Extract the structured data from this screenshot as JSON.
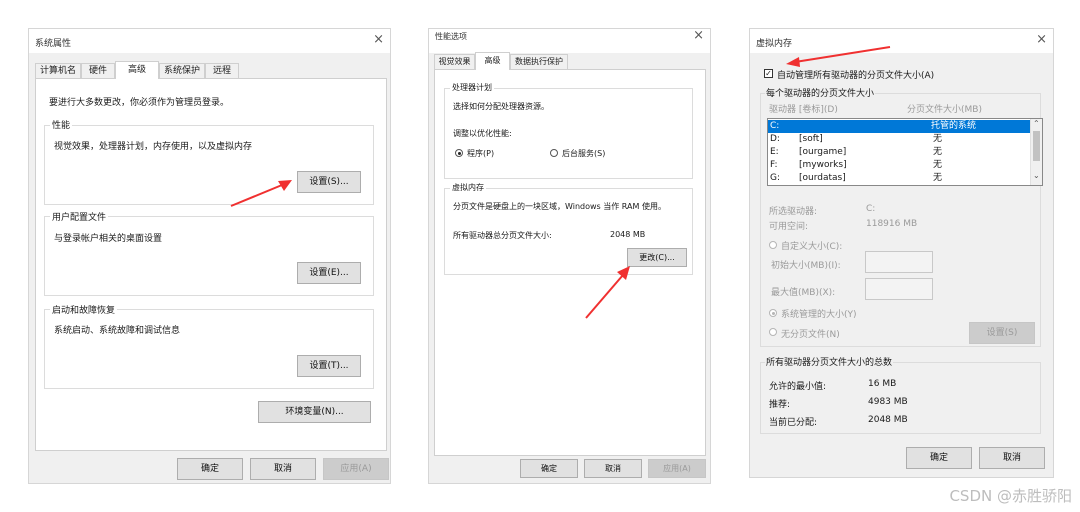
{
  "win1": {
    "title": "系统属性",
    "close": "×",
    "tabs": [
      "计算机名",
      "硬件",
      "高级",
      "系统保护",
      "远程"
    ],
    "intro": "要进行大多数更改，你必须作为管理员登录。",
    "perf_title": "性能",
    "perf_desc": "视觉效果，处理器计划，内存使用，以及虚拟内存",
    "perf_btn": "设置(S)...",
    "profile_title": "用户配置文件",
    "profile_desc": "与登录帐户相关的桌面设置",
    "profile_btn": "设置(E)...",
    "startup_title": "启动和故障恢复",
    "startup_desc": "系统启动、系统故障和调试信息",
    "startup_btn": "设置(T)...",
    "env_btn": "环境变量(N)...",
    "ok": "确定",
    "cancel": "取消",
    "apply": "应用(A)"
  },
  "win2": {
    "title": "性能选项",
    "close": "×",
    "tabs": [
      "视觉效果",
      "高级",
      "数据执行保护"
    ],
    "sched_title": "处理器计划",
    "sched_desc": "选择如何分配处理器资源。",
    "adjust_label": "调整以优化性能:",
    "radio_programs": "程序(P)",
    "radio_background": "后台服务(S)",
    "vm_title": "虚拟内存",
    "vm_desc": "分页文件是硬盘上的一块区域，Windows 当作 RAM 使用。",
    "vm_total_label": "所有驱动器总分页文件大小:",
    "vm_total_value": "2048 MB",
    "change_btn": "更改(C)...",
    "ok": "确定",
    "cancel": "取消",
    "apply": "应用(A)"
  },
  "win3": {
    "title": "虚拟内存",
    "close": "×",
    "auto_manage": "自动管理所有驱动器的分页文件大小(A)",
    "per_drive_title": "每个驱动器的分页文件大小",
    "col_drive": "驱动器 [卷标](D)",
    "col_size": "分页文件大小(MB)",
    "drives": [
      {
        "drive": "C:",
        "label": "",
        "size": "托管的系统",
        "selected": true
      },
      {
        "drive": "D:",
        "label": "[soft]",
        "size": "无",
        "selected": false
      },
      {
        "drive": "E:",
        "label": "[ourgame]",
        "size": "无",
        "selected": false
      },
      {
        "drive": "F:",
        "label": "[myworks]",
        "size": "无",
        "selected": false
      },
      {
        "drive": "G:",
        "label": "[ourdatas]",
        "size": "无",
        "selected": false
      }
    ],
    "selected_drive_label": "所选驱动器:",
    "selected_drive_value": "C:",
    "free_space_label": "可用空间:",
    "free_space_value": "118916 MB",
    "custom_size": "自定义大小(C):",
    "initial_size": "初始大小(MB)(I):",
    "max_size": "最大值(MB)(X):",
    "system_managed": "系统管理的大小(Y)",
    "no_paging": "无分页文件(N)",
    "set_btn": "设置(S)",
    "totals_title": "所有驱动器分页文件大小的总数",
    "min_label": "允许的最小值:",
    "min_value": "16 MB",
    "rec_label": "推荐:",
    "rec_value": "4983 MB",
    "alloc_label": "当前已分配:",
    "alloc_value": "2048 MB",
    "ok": "确定",
    "cancel": "取消"
  },
  "watermark": "CSDN @赤胜骄阳",
  "colors": {
    "arrow": "#f03030",
    "selection": "#0078d7"
  }
}
